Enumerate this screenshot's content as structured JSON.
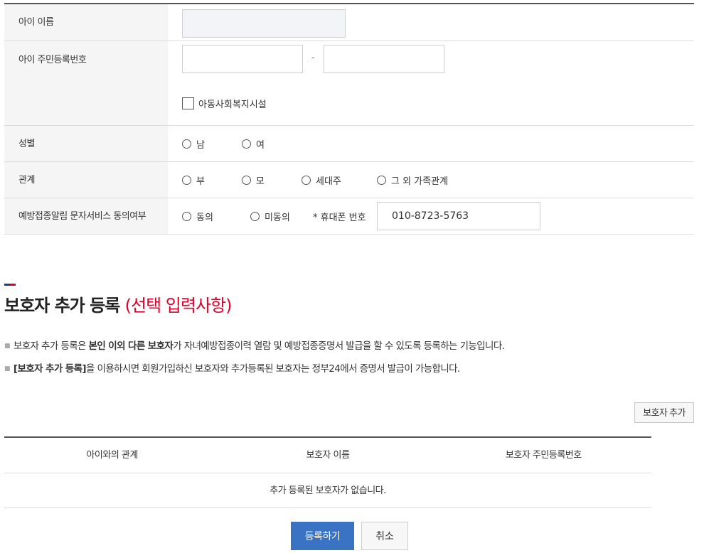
{
  "form": {
    "child_name_label": "아이 이름",
    "child_name_value": "",
    "child_rrn_label": "아이 주민등록번호",
    "rrn_front_value": "",
    "rrn_dash": "-",
    "rrn_back_value": "",
    "welfare_checkbox_label": "아동사회복지시설",
    "gender_label": "성별",
    "gender_options": [
      "남",
      "여"
    ],
    "relation_label": "관계",
    "relation_options": [
      "부",
      "모",
      "세대주",
      "그 외 가족관계"
    ],
    "sms_label": "예방접종알림 문자서비스 동의여부",
    "sms_options": [
      "동의",
      "미동의"
    ],
    "phone_label": "* 휴대폰 번호",
    "phone_value": "010-8723-5763"
  },
  "guardian": {
    "title": "보호자 추가 등록",
    "title_sub": "(선택 입력사항)",
    "accent_colors": [
      "#1f3a8a",
      "#e0002a"
    ],
    "note1_pre": "보호자 추가 등록은 ",
    "note1_bold": "본인 이외 다른 보호자",
    "note1_post": "가 자녀예방접종이력 열람 및 예방접종증명서 발급을 할 수 있도록 등록하는 기능입니다.",
    "note2_bold": "[보호자 추가 등록]",
    "note2_post": "을 이용하시면 회원가입하신 보호자와 추가등록된 보호자는 정부24에서 증명서 발급이 가능합니다.",
    "add_button": "보호자 추가",
    "columns": [
      "아이와의 관계",
      "보호자 이름",
      "보호자 주민등록번호"
    ],
    "empty_message": "추가 등록된 보호자가 없습니다."
  },
  "actions": {
    "submit": "등록하기",
    "cancel": "취소"
  }
}
